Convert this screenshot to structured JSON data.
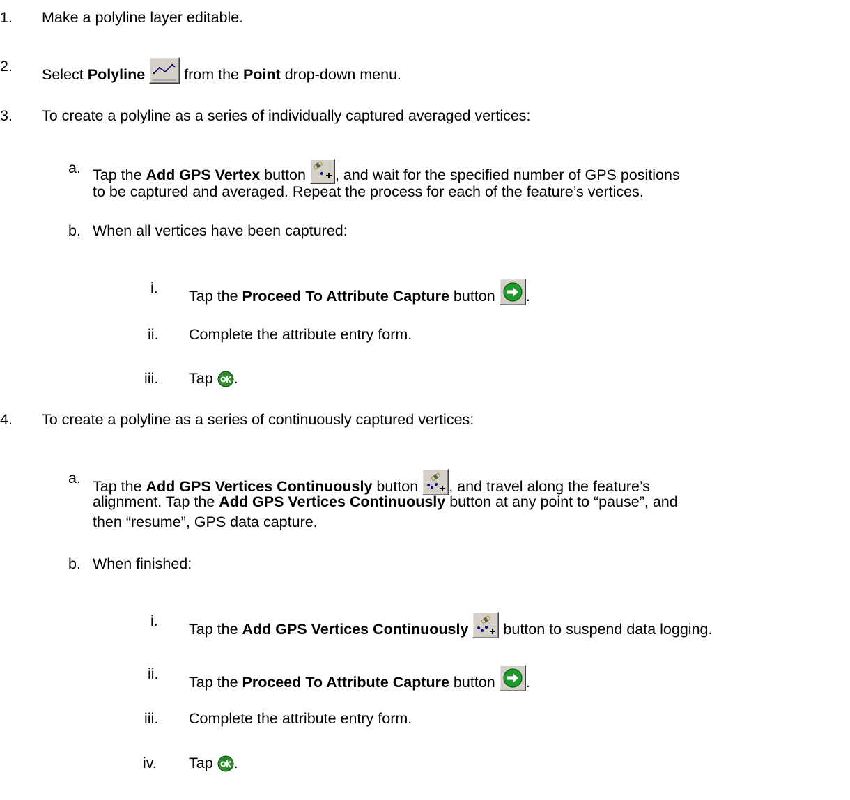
{
  "steps": [
    {
      "num": "1.",
      "text": "Make a polyline layer editable."
    },
    {
      "num": "2.",
      "pre": "Select ",
      "b1": "Polyline",
      "mid": " from the ",
      "b2": "Point",
      "post": " drop-down menu."
    },
    {
      "num": "3.",
      "text": "To create a polyline as a series of individually captured averaged vertices:",
      "sub": [
        {
          "num": "a.",
          "pre": "Tap the ",
          "bold": "Add GPS Vertex",
          "post": " button",
          "post2": ", and wait for the specified number of GPS positions",
          "cont": "to be captured and averaged.  Repeat the process for each of the feature’s vertices."
        },
        {
          "num": "b.",
          "text": "When all vertices have been captured:",
          "items": [
            {
              "num": "i.",
              "pre": "Tap the ",
              "bold": "Proceed To Attribute Capture",
              "post": " button",
              "post2": "."
            },
            {
              "num": "ii.",
              "text": "Complete the attribute entry form."
            },
            {
              "num": "iii.",
              "pre": "Tap ",
              "post2": "."
            }
          ]
        }
      ]
    },
    {
      "num": "4.",
      "text": "To create a polyline as a series of continuously captured vertices:",
      "sub": [
        {
          "num": "a.",
          "pre": "Tap the ",
          "bold": "Add GPS Vertices Continuously",
          "post": " button",
          "post2": ", and travel along the feature’s",
          "cont1_pre": "alignment.  Tap the ",
          "cont1_bold": "Add GPS Vertices Continuously",
          "cont1_post": " button at any point to “pause”, and",
          "cont2": "then “resume”, GPS data capture."
        },
        {
          "num": "b.",
          "text": "When finished:",
          "items": [
            {
              "num": "i.",
              "pre": "Tap the ",
              "bold": "Add GPS Vertices Continuously",
              "post2": " button to suspend data logging."
            },
            {
              "num": "ii.",
              "pre": "Tap the ",
              "bold": "Proceed To Attribute Capture",
              "post": " button",
              "post2": "."
            },
            {
              "num": "iii.",
              "text": "Complete the attribute entry form."
            },
            {
              "num": "iv.",
              "pre": "Tap ",
              "post2": "."
            }
          ]
        }
      ]
    }
  ],
  "icons": {
    "polyline": "polyline-tool-icon",
    "add_vertex": "add-gps-vertex-icon",
    "add_continuous": "add-gps-vertices-continuously-icon",
    "proceed": "green-arrow-icon",
    "ok": "ok-icon"
  },
  "colors": {
    "icon_face": "#d4d0c8",
    "proceed_green": "#1e9c2a",
    "ok_green": "#2d8b2d"
  }
}
